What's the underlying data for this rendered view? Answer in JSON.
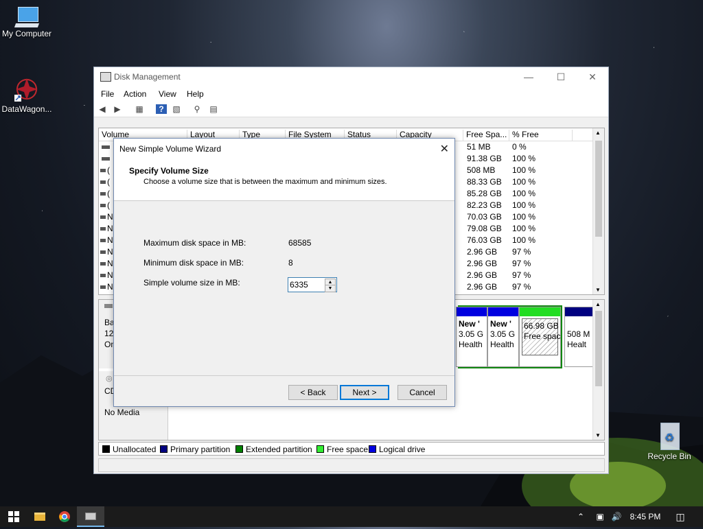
{
  "desktop": {
    "icons": [
      {
        "label": "My Computer",
        "icon": "computer-icon"
      },
      {
        "label": "DataWagon...",
        "icon": "datawagon-shortcut-icon"
      },
      {
        "label": "Recycle Bin",
        "icon": "recycle-bin-icon"
      }
    ]
  },
  "window": {
    "title": "Disk Management",
    "menu": [
      "File",
      "Action",
      "View",
      "Help"
    ],
    "toolbar_icons": [
      "back-arrow-icon",
      "forward-arrow-icon",
      "properties-icon",
      "help-icon",
      "console-icon",
      "connect-icon",
      "settings-icon"
    ]
  },
  "volume_list": {
    "columns": [
      "Volume",
      "Layout",
      "Type",
      "File System",
      "Status",
      "Capacity",
      "Free Spa...",
      "% Free"
    ],
    "left_glyphs": [
      "",
      "",
      "(",
      "(",
      "(",
      "(",
      "N",
      "N",
      "N",
      "N",
      "N",
      "N",
      "N"
    ],
    "rows": [
      {
        "free": "51 MB",
        "pct": "0 %"
      },
      {
        "free": "91.38 GB",
        "pct": "100 %"
      },
      {
        "free": "508 MB",
        "pct": "100 %"
      },
      {
        "free": "88.33 GB",
        "pct": "100 %"
      },
      {
        "free": "85.28 GB",
        "pct": "100 %"
      },
      {
        "free": "82.23 GB",
        "pct": "100 %"
      },
      {
        "free": "70.03 GB",
        "pct": "100 %"
      },
      {
        "free": "79.08 GB",
        "pct": "100 %"
      },
      {
        "free": "76.03 GB",
        "pct": "100 %"
      },
      {
        "free": "2.96 GB",
        "pct": "97 %"
      },
      {
        "free": "2.96 GB",
        "pct": "97 %"
      },
      {
        "free": "2.96 GB",
        "pct": "97 %"
      },
      {
        "free": "2.96 GB",
        "pct": "97 %"
      }
    ]
  },
  "disk_pane": {
    "disk0": {
      "l1": "Ba",
      "l2": "12(",
      "l3": "On"
    },
    "cd": {
      "l1": "CD",
      "l2": "No Media"
    },
    "partitions": [
      {
        "name": "New '",
        "size": "3.05 G",
        "status": "Health",
        "color": "#0000e0"
      },
      {
        "name": "New '",
        "size": "3.05 G",
        "status": "Health",
        "color": "#0000e0"
      },
      {
        "name": "",
        "size": "66.98 GB",
        "status": "Free spac",
        "color": "#22dd22"
      },
      {
        "name": "",
        "size": "508 M",
        "status": "Healt",
        "color": "#000080"
      }
    ]
  },
  "legend": [
    {
      "label": "Unallocated",
      "color": "#000000"
    },
    {
      "label": "Primary partition",
      "color": "#000080"
    },
    {
      "label": "Extended partition",
      "color": "#008000"
    },
    {
      "label": "Free space",
      "color": "#33ee33"
    },
    {
      "label": "Logical drive",
      "color": "#0000e0"
    }
  ],
  "wizard": {
    "title": "New Simple Volume Wizard",
    "heading": "Specify Volume Size",
    "subheading": "Choose a volume size that is between the maximum and minimum sizes.",
    "max_label": "Maximum disk space in MB:",
    "max_value": "68585",
    "min_label": "Minimum disk space in MB:",
    "min_value": "8",
    "size_label": "Simple volume size in MB:",
    "size_value": "6335",
    "back": "< Back",
    "next": "Next >",
    "cancel": "Cancel"
  },
  "taskbar": {
    "time": "8:45 PM",
    "icons": [
      "start-icon",
      "file-explorer-icon",
      "chrome-icon",
      "disk-management-icon"
    ],
    "tray_icons": [
      "chevron-up-icon",
      "network-icon",
      "volume-icon",
      "notifications-icon"
    ]
  }
}
